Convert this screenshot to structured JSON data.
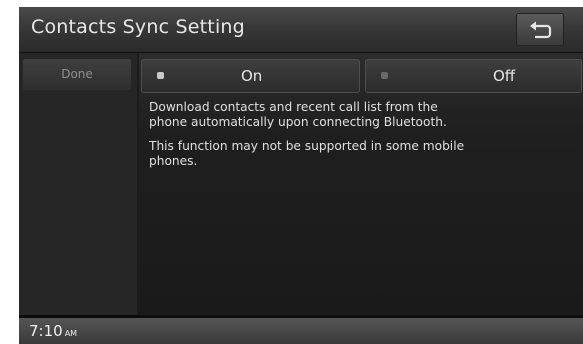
{
  "header": {
    "title": "Contacts Sync Setting",
    "back_icon": "back-arrow-icon"
  },
  "sidebar": {
    "done_label": "Done"
  },
  "options": [
    {
      "label": "On",
      "selected": true
    },
    {
      "label": "Off",
      "selected": false
    }
  ],
  "description": {
    "line1": "Download contacts and recent call list from the phone automatically upon connecting Bluetooth.",
    "line2": "This function may not be supported in some mobile phones."
  },
  "status": {
    "time": "7:10",
    "ampm": "AM"
  }
}
